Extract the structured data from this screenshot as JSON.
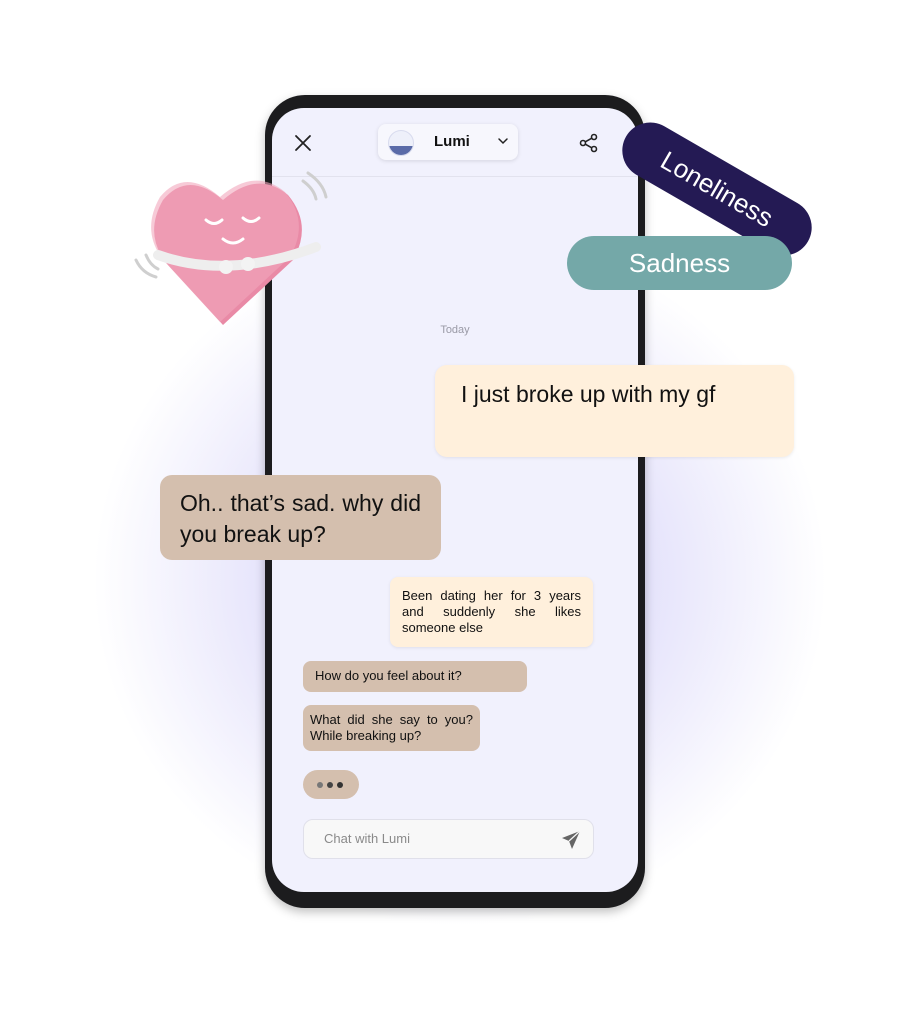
{
  "header": {
    "title": "Lumi",
    "close_icon": "close-icon",
    "share_icon": "share-icon",
    "dropdown_icon": "chevron-down-icon"
  },
  "chat": {
    "date_divider": "Today",
    "messages": [
      {
        "sender": "user",
        "text": "Been dating her for 3 years and suddenly she likes someone else"
      },
      {
        "sender": "bot",
        "text": "How do you feel about it?"
      },
      {
        "sender": "bot",
        "text": "What did she say to you? While breaking up?"
      }
    ],
    "typing_indicator": true
  },
  "input": {
    "placeholder": "Chat with Lumi",
    "value": "",
    "send_icon": "send-icon"
  },
  "floating": {
    "user_message": "I just broke up with my gf",
    "bot_message": "Oh.. that’s sad. why did you break up?",
    "tags": [
      {
        "label": "Loneliness",
        "color": "#241a54"
      },
      {
        "label": "Sadness",
        "color": "#74a8a8"
      }
    ]
  },
  "colors": {
    "user_bubble": "#fff0dc",
    "bot_bubble": "#d4bfae",
    "screen_bg": "#f1f1fd"
  }
}
